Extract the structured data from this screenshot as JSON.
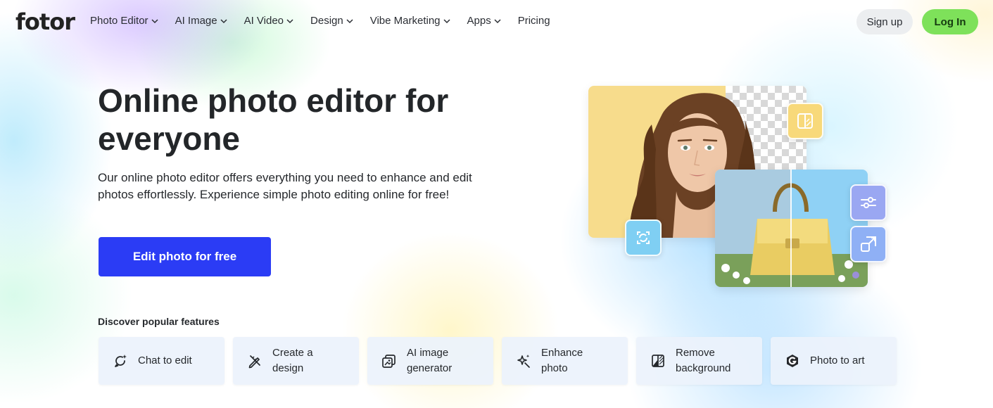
{
  "brand": {
    "logo_text": "fotor"
  },
  "nav": {
    "items": [
      {
        "label": "Photo Editor",
        "has_dropdown": true
      },
      {
        "label": "AI Image",
        "has_dropdown": true
      },
      {
        "label": "AI Video",
        "has_dropdown": true
      },
      {
        "label": "Design",
        "has_dropdown": true
      },
      {
        "label": "Vibe Marketing",
        "has_dropdown": true
      },
      {
        "label": "Apps",
        "has_dropdown": true
      },
      {
        "label": "Pricing",
        "has_dropdown": false
      }
    ],
    "signup_label": "Sign up",
    "login_label": "Log In"
  },
  "hero": {
    "title": "Online photo editor for everyone",
    "subtitle": "Our online photo editor offers everything you need to enhance and edit photos effortlessly. Experience simple photo editing online for free!",
    "cta_label": "Edit photo for free"
  },
  "features": {
    "heading": "Discover popular features",
    "items": [
      {
        "label": "Chat to edit",
        "icon": "chat-sparkle-icon"
      },
      {
        "label": "Create a design",
        "icon": "design-pencil-icon"
      },
      {
        "label": "AI image generator",
        "icon": "ai-image-icon"
      },
      {
        "label": "Enhance photo",
        "icon": "enhance-sparkle-icon"
      },
      {
        "label": "Remove background",
        "icon": "remove-background-icon"
      },
      {
        "label": "Photo to art",
        "icon": "photo-to-art-icon"
      }
    ]
  },
  "colors": {
    "cta": "#2b3cf5",
    "login": "#7ee15a",
    "signup": "#eceef0"
  },
  "collage": {
    "badges": [
      "split-compare-icon",
      "sliders-icon",
      "resize-icon",
      "refresh-face-icon"
    ]
  }
}
